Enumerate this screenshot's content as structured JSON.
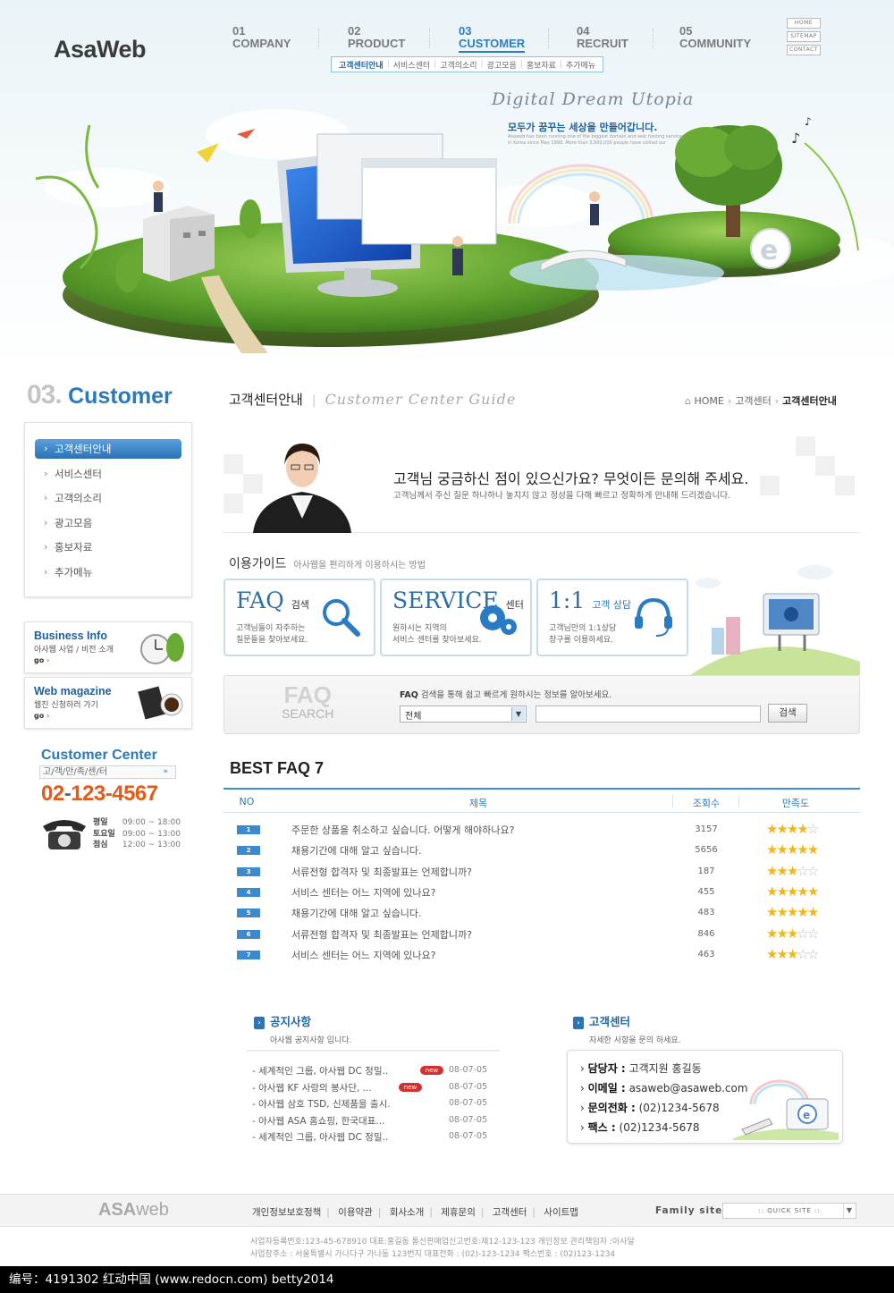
{
  "header": {
    "logo": "AsaWeb",
    "nav": [
      {
        "num": "01",
        "label": "COMPANY"
      },
      {
        "num": "02",
        "label": "PRODUCT"
      },
      {
        "num": "03",
        "label": "CUSTOMER"
      },
      {
        "num": "04",
        "label": "RECRUIT"
      },
      {
        "num": "05",
        "label": "COMMUNITY"
      }
    ],
    "subnav": [
      "고객센터안내",
      "서비스센터",
      "고객의소리",
      "광고모음",
      "홍보자료",
      "추가메뉴"
    ],
    "util": [
      "HOME",
      "SITEMAP",
      "CONTACT"
    ]
  },
  "hero": {
    "slogan_en": "Digital Dream Utopia",
    "slogan_kr": "모두가 꿈꾸는 세상을 만들어갑니다.",
    "slogan_small": "Asaweb has been running one of the biggest domain and web hosting services in Korea since May 1998. More than 3,000,000 people have visited our"
  },
  "sidebar": {
    "title_num": "03.",
    "title": "Customer",
    "items": [
      "고객센터안내",
      "서비스센터",
      "고객의소리",
      "광고모음",
      "홍보자료",
      "추가메뉴"
    ],
    "banners": [
      {
        "title": "Business Info",
        "sub": "아사웹 사업 / 비전 소개",
        "go": "go"
      },
      {
        "title": "Web magazine",
        "sub": "웹진 신청하러 가기",
        "go": "go"
      }
    ],
    "cc_title": "Customer Center",
    "cc_bar": "고/객/만/족/센/터",
    "cc_phone_a": "02",
    "cc_phone_sep": "-",
    "cc_phone_b": "123-4567",
    "hours": [
      {
        "k": "평일",
        "v": "09:00 ~ 18:00"
      },
      {
        "k": "토요일",
        "v": "09:00 ~ 13:00"
      },
      {
        "k": "점심",
        "v": "12:00 ~ 13:00"
      }
    ]
  },
  "main": {
    "title_kr": "고객센터안내",
    "title_sep": "|",
    "title_en": "Customer Center Guide",
    "breadcrumb": [
      "HOME",
      "고객센터",
      "고객센터안내"
    ],
    "intro_head": "고객님 궁금하신 점이 있으신가요? 무엇이든 문의해 주세요.",
    "intro_sub": "고객님께서 주신 질문 하나하나 놓치지 않고 정성을 다해 빠르고 정확하게 안내해 드리겠습니다.",
    "guide_title": "이용가이드",
    "guide_sub": "아사웹을 편리하게 이용하시는 방법",
    "guide_boxes": [
      {
        "big": "FAQ",
        "small": "검색",
        "d1": "고객님들이 자주하는",
        "d2": "질문들을 찾아보세요."
      },
      {
        "big": "SERVICE",
        "small": "센터",
        "d1": "원하시는 지역의",
        "d2": "서비스 센터를 찾아보세요."
      },
      {
        "big": "1:1",
        "small": "고객 상담",
        "d1": "고객님만의 1:1상담",
        "d2": "창구를 이용하세요."
      }
    ],
    "search": {
      "logo_big": "FAQ",
      "logo_small": "SEARCH",
      "desc_bold": "FAQ",
      "desc": "검색을 통해 쉽고 빠르게 원하시는 정보를 알아보세요.",
      "select_value": "전체",
      "button": "검색"
    },
    "best_title": "BEST FAQ 7",
    "faq_columns": [
      "NO",
      "제목",
      "조회수",
      "만족도"
    ],
    "faq_rows": [
      {
        "no": "1",
        "title": "주문한 상품을 취소하고 싶습니다. 어떻게 해야하나요?",
        "hits": "3157",
        "rating": 4
      },
      {
        "no": "2",
        "title": "채용기간에 대해 알고 싶습니다.",
        "hits": "5656",
        "rating": 5
      },
      {
        "no": "3",
        "title": "서류전형 합격자 및 최종발표는 언제합니까?",
        "hits": "187",
        "rating": 3
      },
      {
        "no": "4",
        "title": "서비스 센터는 어느 지역에 있나요?",
        "hits": "455",
        "rating": 5
      },
      {
        "no": "5",
        "title": "채용기간에 대해 알고 싶습니다.",
        "hits": "483",
        "rating": 5
      },
      {
        "no": "6",
        "title": "서류전형 합격자 및 최종발표는 언제합니까?",
        "hits": "846",
        "rating": 3
      },
      {
        "no": "7",
        "title": "서비스 센터는 어느 지역에 있나요?",
        "hits": "463",
        "rating": 3
      }
    ]
  },
  "notice": {
    "title": "공지사항",
    "sub": "아사웹 공지사항 입니다.",
    "items": [
      {
        "title": "- 세계적인 그룹, 아사웹 DC 정밀..",
        "new": "new",
        "date": "08-07-05"
      },
      {
        "title": "- 아사웹 KF 사랑의 봉사단, ...",
        "new": "new",
        "date": "08-07-05"
      },
      {
        "title": "- 아사웹 삼호 TSD, 신제품을 출시.",
        "new": "",
        "date": "08-07-05"
      },
      {
        "title": "- 아사웹 ASA 홈쇼핑, 한국대표...",
        "new": "",
        "date": "08-07-05"
      },
      {
        "title": "- 세계적인 그룹, 아사웹 DC 정밀..",
        "new": "",
        "date": "08-07-05"
      }
    ]
  },
  "contact": {
    "title": "고객센터",
    "sub": "자세한 사항을 문의 하세요.",
    "rows": [
      {
        "k": "담당자 :",
        "v": "고객지원 홍길동"
      },
      {
        "k": "이메일 :",
        "v": "asaweb@asaweb.com"
      },
      {
        "k": "문의전화 :",
        "v": "(02)1234-5678"
      },
      {
        "k": "팩스 :",
        "v": "(02)1234-5678"
      }
    ]
  },
  "footer": {
    "logo_a": "ASA",
    "logo_b": "web",
    "links": [
      "개인정보보호정책",
      "이용약관",
      "회사소개",
      "제휴문의",
      "고객센터",
      "사이트맵"
    ],
    "family_label": "Family site",
    "family_select": ":: QUICK SITE ::",
    "info1": "사업자등록번호:123-45-678910 대표:홍길동 통신판매업신고번호:제12-123-123 개인정보 관리책임자 :아사달",
    "info2": "사업장주소 : 서울특별시 가나다구 가나동 123번지 대표전화 : (02)-123-1234 팩스번호 : (02)123-1234"
  },
  "watermark": "编号：4191302    红动中国 (www.redocn.com)    betty2014",
  "colors": {
    "accent": "#2b79b9",
    "phone": "#e25b1a",
    "star": "#f3b61a",
    "new_badge": "#d62f2f"
  }
}
